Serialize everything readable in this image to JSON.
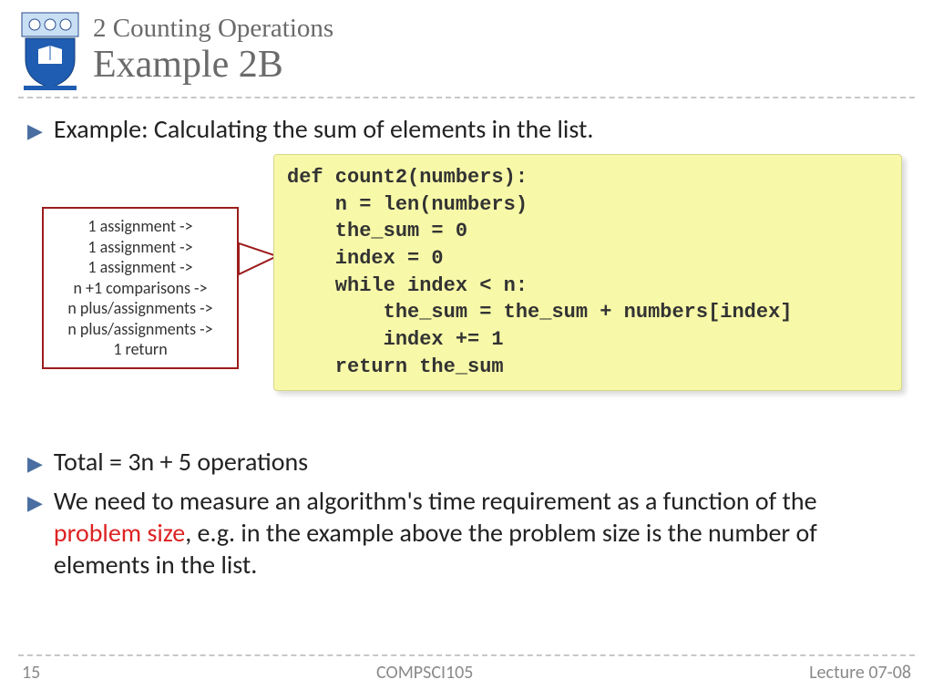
{
  "header": {
    "subtitle": "2 Counting Operations",
    "title": "Example 2B"
  },
  "bullets": {
    "b1": "Example: Calculating the sum of elements in the list.",
    "b2": "Total = 3n + 5 operations",
    "b3a": "We need to measure an algorithm's time requirement as a function of the ",
    "b3_highlight": "problem size",
    "b3b": ", e.g. in the example above the problem size is the number of elements in the list."
  },
  "callout": {
    "l1": "1 assignment ->",
    "l2": "1 assignment ->",
    "l3": "1 assignment ->",
    "l4": "n +1 comparisons ->",
    "l5": "n plus/assignments ->",
    "l6": "n plus/assignments ->",
    "l7": "1 return"
  },
  "code": "def count2(numbers):\n    n = len(numbers)\n    the_sum = 0\n    index = 0\n    while index < n:\n        the_sum = the_sum + numbers[index]\n        index += 1\n    return the_sum",
  "footer": {
    "page": "15",
    "course": "COMPSCI105",
    "lecture": "Lecture 07-08"
  }
}
